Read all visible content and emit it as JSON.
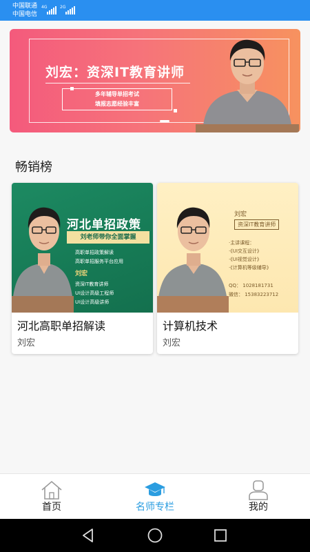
{
  "status_bar": {
    "carrier1": "中国联通",
    "carrier2": "中国电信",
    "signal1_type": "4G",
    "signal2_type": "2G",
    "bg_color": "#2a8ff0"
  },
  "banner": {
    "title": "刘宏：资深IT教育讲师",
    "sub_line1": "多年辅导单招考试",
    "sub_line2": "填报志愿经验丰富"
  },
  "bestseller": {
    "section_title": "畅销榜",
    "courses": [
      {
        "title": "河北高职单招解读",
        "author": "刘宏",
        "cover": {
          "headline": "河北单招政策",
          "ribbon": "刘老师带你全面掌握",
          "lines": [
            "高职单招政策解读",
            "高职单招服务平台应用"
          ],
          "name": "刘宏",
          "roles": [
            "资深IT教育讲师",
            "UI设计高级工程师",
            "UI设计高级讲师"
          ]
        }
      },
      {
        "title": "计算机技术",
        "author": "刘宏",
        "cover": {
          "name": "刘宏",
          "badge": "资深IT教育讲师",
          "courses_label": "·主讲课程：",
          "courses": [
            "·《UI交互设计》",
            "·《UI视觉设计》",
            "·《计算机等级辅导》"
          ],
          "qq": "QQ： 1028181731",
          "wechat": "微信： 15383223712"
        }
      }
    ]
  },
  "tab_bar": {
    "active_color": "#2b9de0",
    "tabs": [
      {
        "label": "首页",
        "icon": "home-icon"
      },
      {
        "label": "名师专栏",
        "icon": "graduation-cap-icon"
      },
      {
        "label": "我的",
        "icon": "user-icon"
      }
    ]
  },
  "system_nav": {
    "back": "back-icon",
    "home": "home-circle-icon",
    "recents": "recents-icon"
  }
}
